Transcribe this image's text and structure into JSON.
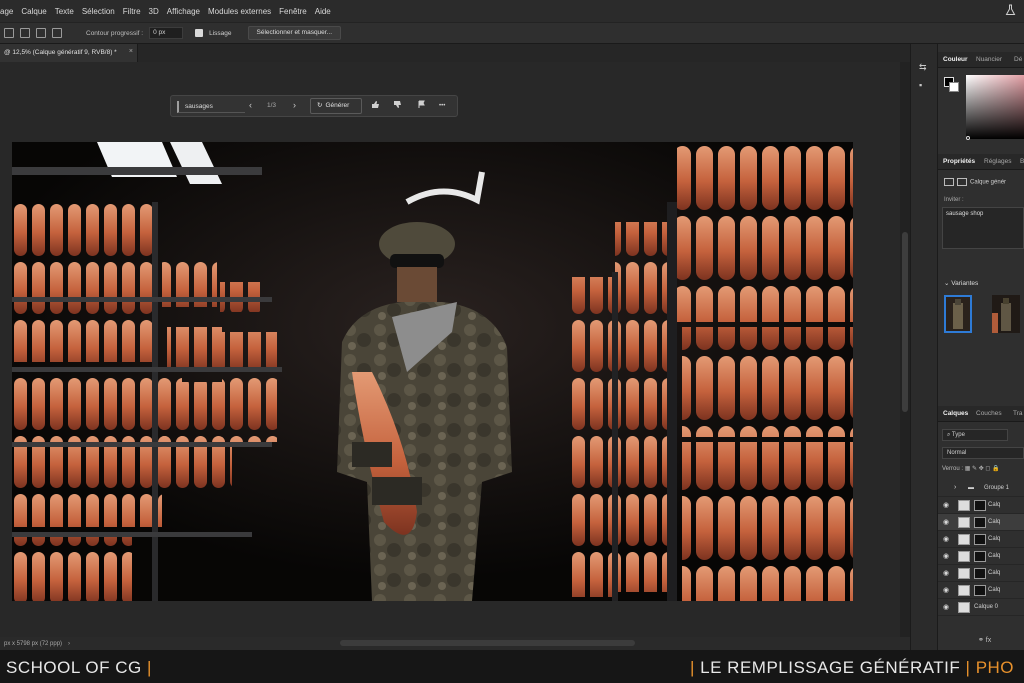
{
  "menubar": {
    "items": [
      "age",
      "Calque",
      "Texte",
      "Sélection",
      "Filtre",
      "3D",
      "Affichage",
      "Modules externes",
      "Fenêtre",
      "Aide"
    ]
  },
  "options": {
    "contour_label": "Contour progressif :",
    "contour_value": "0 px",
    "lissage_label": "Lissage",
    "select_mask_label": "Sélectionner et masquer..."
  },
  "document": {
    "tab_title": "@ 12,5% (Calque génératif 9, RVB/8) *",
    "close_glyph": "×"
  },
  "contextual_bar": {
    "prompt_value": "sausages",
    "counter": "1/3",
    "prev_glyph": "‹",
    "next_glyph": "›",
    "generate_label": "Générer",
    "more_glyph": "•••"
  },
  "status": {
    "text": "px x 5798 px (72 ppp)",
    "arrow_glyph": "›"
  },
  "panels": {
    "color_tabs": [
      "Couleur",
      "Nuancier",
      "Dé"
    ],
    "properties_tabs": [
      "Propriétés",
      "Réglages",
      "B"
    ],
    "layer_type": "Calque génér",
    "invite_label": "Inviter :",
    "invite_value": "sausage shop",
    "variants_label": "Variantes",
    "layers_tabs": [
      "Calques",
      "Couches",
      "Tra"
    ],
    "search_label": "Type",
    "blend_mode": "Normal",
    "lock_label": "Verrou :",
    "layers": [
      {
        "name": "Groupe 1",
        "type": "group"
      },
      {
        "name": "Calq",
        "type": "gen"
      },
      {
        "name": "Calq",
        "type": "gen",
        "selected": true
      },
      {
        "name": "Calq",
        "type": "gen"
      },
      {
        "name": "Calq",
        "type": "gen"
      },
      {
        "name": "Calq",
        "type": "gen"
      },
      {
        "name": "Calq",
        "type": "gen"
      },
      {
        "name": "Calque 0",
        "type": "pixel"
      }
    ],
    "footer_icons": "⚭ fx"
  },
  "caption": {
    "left": "SCHOOL OF CG",
    "right": "LE REMPLISSAGE GÉNÉRATIF",
    "right_tail": "PHO",
    "separator": "|"
  },
  "colors": {
    "accent_orange": "#e8912c",
    "selection_blue": "#2e7bd6"
  }
}
